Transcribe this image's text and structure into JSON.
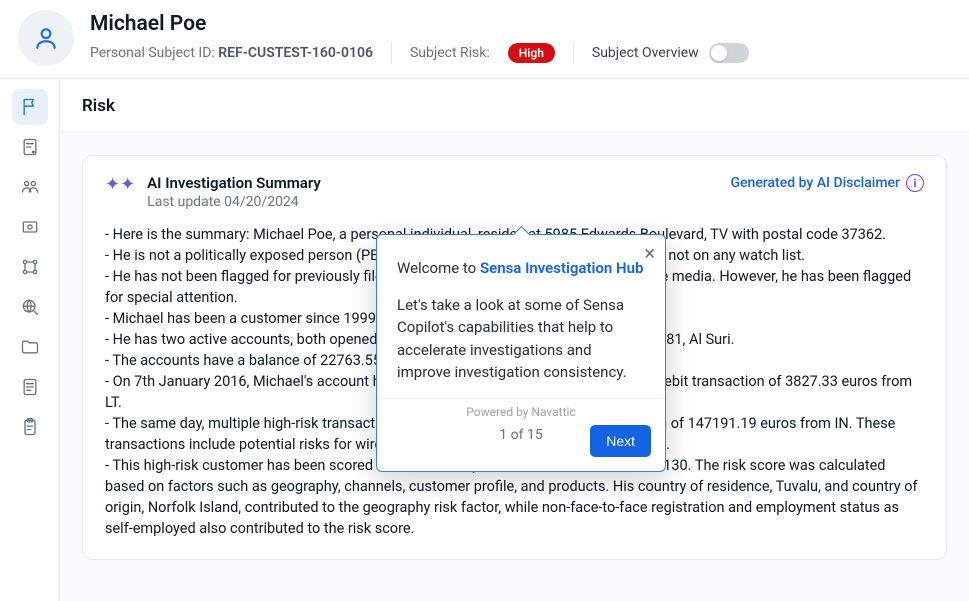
{
  "header": {
    "name": "Michael Poe",
    "id_label": "Personal Subject ID:",
    "id_value": "REF-CUSTEST-160-0106",
    "risk_label": "Subject Risk:",
    "risk_value": "High",
    "overview_label": "Subject Overview",
    "overview_on": false
  },
  "sidebar": {
    "items": [
      {
        "name": "tab-risk",
        "icon": "flag",
        "active": true
      },
      {
        "name": "tab-doc-alert",
        "icon": "doc-alert",
        "active": false
      },
      {
        "name": "tab-people",
        "icon": "people",
        "active": false
      },
      {
        "name": "tab-frame",
        "icon": "frame",
        "active": false
      },
      {
        "name": "tab-graph",
        "icon": "graph",
        "active": false
      },
      {
        "name": "tab-globe",
        "icon": "globe-search",
        "active": false
      },
      {
        "name": "tab-folder",
        "icon": "folder",
        "active": false
      },
      {
        "name": "tab-doc-lines",
        "icon": "doc-lines",
        "active": false
      },
      {
        "name": "tab-clipboard",
        "icon": "clipboard",
        "active": false
      }
    ]
  },
  "main": {
    "title": "Risk"
  },
  "card": {
    "title": "AI Investigation Summary",
    "subtitle": "Last update 04/20/2024",
    "disclaimer": "Generated by AI Disclaimer"
  },
  "summary_lines": [
    "- Here is the summary: Michael Poe, a personal individual, resides at 5985 Edwards Boulevard, TV with postal code 37362.",
    "- He is not a politically exposed person (PEP) and not related to a sensitive position and not on any watch list.",
    "- He has not been flagged for previously filed SAR, any legal/dispute position, or adverse media. However, he has been flagged for special attention.",
    "- Michael has been a customer since 1999, with a residence in Tuvalu in his own capital.",
    "- He has two active accounts, both opened in 2011 at branch GB24BARC20040158314681, Al Suri.",
    "- The accounts have a balance of 22763.55 and 26132.89 euros respectively.",
    "- On 7th January 2016, Michael's account had an international wire transaction, with a debit transaction of 3827.33 euros from LT.",
    "- The same day, multiple high-risk transactions were made including a credit transaction of 147191.19 euros from IN. These transactions include potential risks for wire stripping, terrorist financing, and tax havens.",
    "- This high-risk customer has been scored at 300, 132.32 points above the threshold of 130. The risk score was calculated based on factors such as geography, channels, customer profile, and products. His country of residence, Tuvalu, and country of origin, Norfolk Island, contributed to the geography risk factor, while non-face-to-face registration and employment status as self-employed also contributed to the risk score."
  ],
  "popover": {
    "welcome_prefix": "Welcome to ",
    "welcome_link": "Sensa Investigation Hub",
    "body": "Let's take a look at some of Sensa Copilot's capabilities that help to accelerate investigations and improve investigation consistency.",
    "powered": "Powered by Navattic",
    "step": "1 of 15",
    "next": "Next"
  }
}
